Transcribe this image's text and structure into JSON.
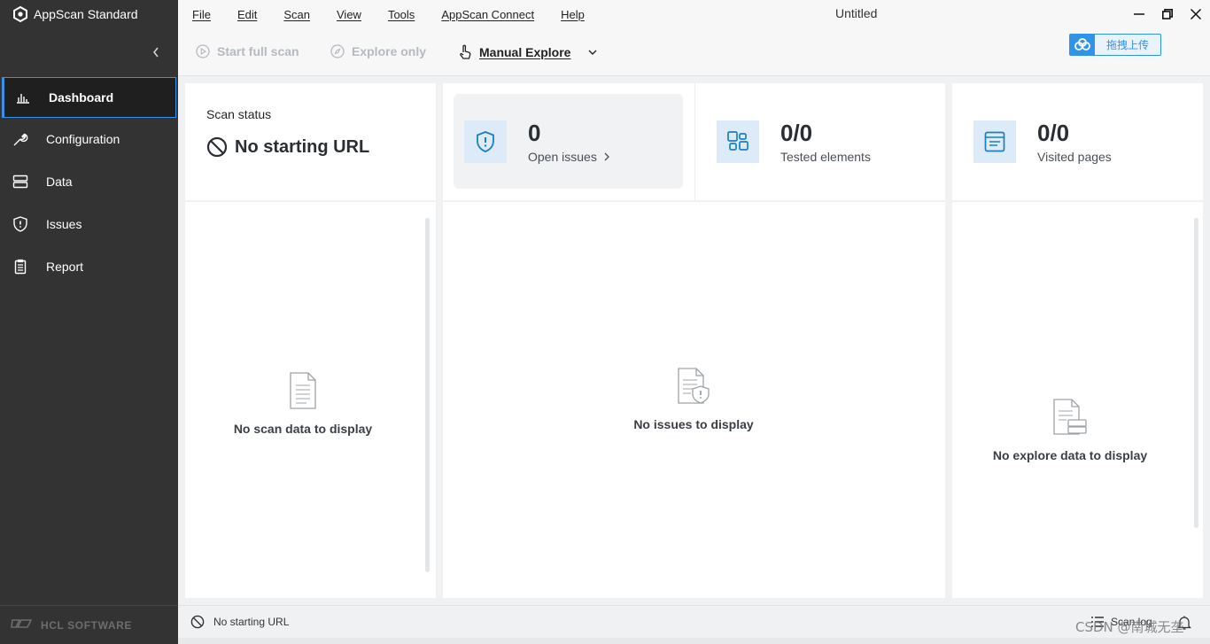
{
  "app": {
    "name": "AppScan Standard",
    "window_title": "Untitled",
    "vendor": "HCL SOFTWARE"
  },
  "menu": {
    "items": [
      "File",
      "Edit",
      "Scan",
      "View",
      "Tools",
      "AppScan Connect",
      "Help"
    ]
  },
  "toolbar": {
    "start_full_scan": "Start full scan",
    "explore_only": "Explore only",
    "manual_explore": "Manual Explore",
    "upload": "拖拽上传"
  },
  "sidebar": {
    "items": [
      {
        "label": "Dashboard",
        "icon": "bar-chart-icon",
        "active": true
      },
      {
        "label": "Configuration",
        "icon": "wrench-icon",
        "active": false
      },
      {
        "label": "Data",
        "icon": "database-icon",
        "active": false
      },
      {
        "label": "Issues",
        "icon": "shield-icon",
        "active": false
      },
      {
        "label": "Report",
        "icon": "clipboard-icon",
        "active": false
      }
    ]
  },
  "dashboard": {
    "scan_status": {
      "label": "Scan status",
      "value": "No starting URL"
    },
    "open_issues": {
      "value": "0",
      "label": "Open issues"
    },
    "tested_elements": {
      "value": "0/0",
      "label": "Tested elements"
    },
    "visited_pages": {
      "value": "0/0",
      "label": "Visited pages"
    },
    "empty_scan": "No scan data to display",
    "empty_issues": "No issues to display",
    "empty_explore": "No explore data to display"
  },
  "statusbar": {
    "status": "No starting URL",
    "scan_log": "Scan log"
  },
  "watermark": "CSDN @南城无垄",
  "colors": {
    "sidebar_bg": "#333333",
    "accent": "#3b8fe5",
    "icon_blue": "#1a7fc1",
    "icon_tile": "#dcebf7"
  }
}
